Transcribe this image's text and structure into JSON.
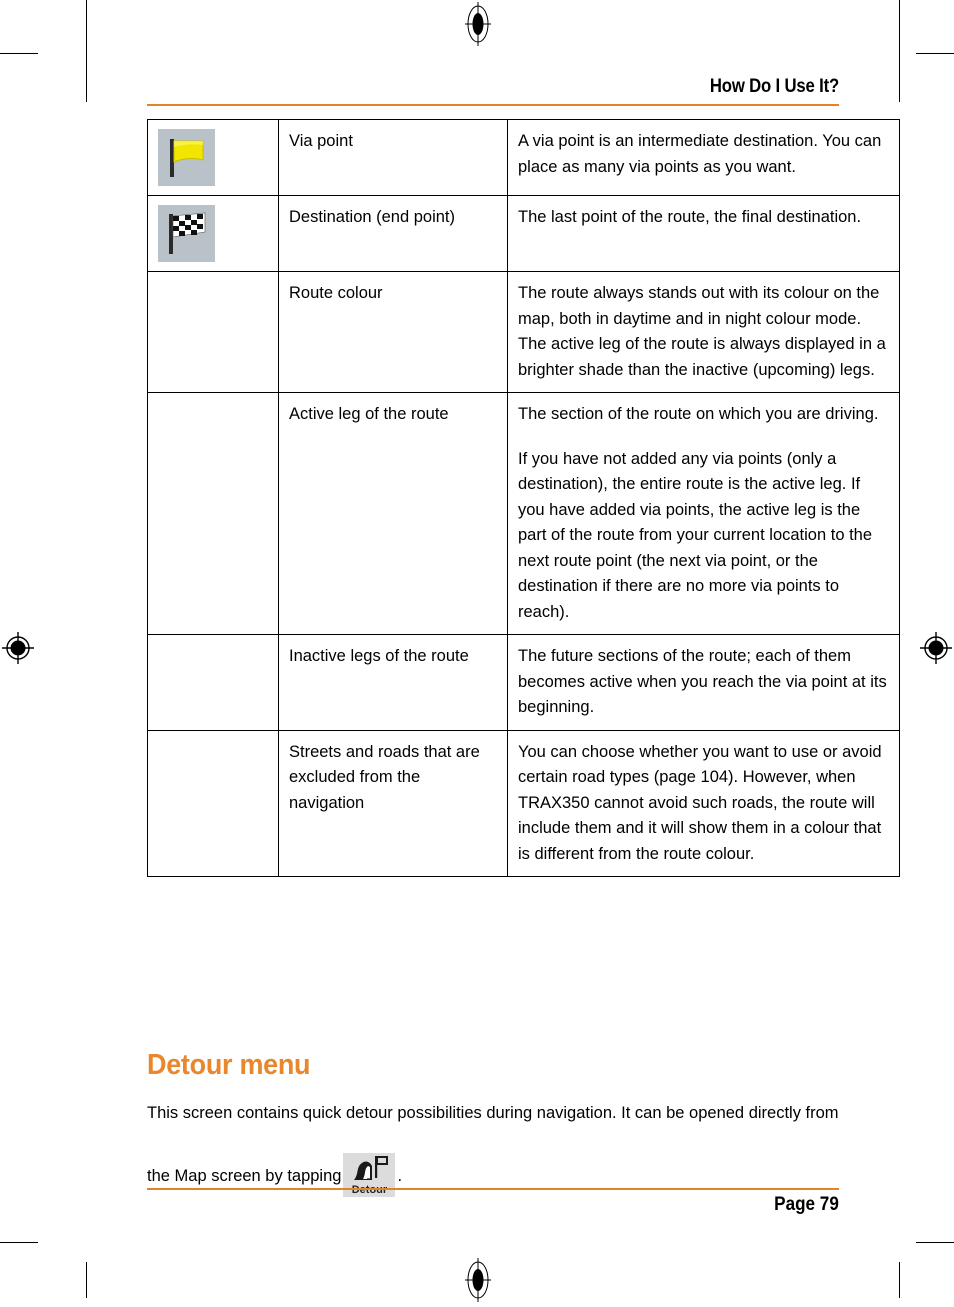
{
  "header": {
    "running_title": "How Do I Use It?"
  },
  "footer": {
    "page_label": "Page 79"
  },
  "colors": {
    "accent_orange": "#E18326",
    "heading_orange": "#E8872B",
    "icon_background": "#B9C2C9",
    "flag_yellow": "#F2E500"
  },
  "table": {
    "rows": [
      {
        "icon": "yellow-flag-icon",
        "term": "Via point",
        "paragraphs": [
          "A via point is an intermediate destination. You can place as many via points as you want."
        ]
      },
      {
        "icon": "checkered-flag-icon",
        "term": "Destination (end point)",
        "paragraphs": [
          "The last point of the route, the final destination."
        ]
      },
      {
        "icon": "",
        "term": "Route colour",
        "paragraphs": [
          "The route always stands out with its colour on the map, both in daytime and in night colour mode. The active leg of the route is always displayed in a brighter shade than the inactive (upcoming) legs."
        ]
      },
      {
        "icon": "",
        "term": "Active leg of the route",
        "paragraphs": [
          "The section of the route on which you are driving.",
          "If you have not added any via points (only a destination), the entire route is the active leg. If you have added via points, the active leg is the part of the route from your current location to the next route point (the next via point, or the destination if there are no more via points to reach)."
        ]
      },
      {
        "icon": "",
        "term": "Inactive legs of the route",
        "paragraphs": [
          "The future sections of the route; each of them becomes active when you reach the via point at its beginning."
        ]
      },
      {
        "icon": "",
        "term": "Streets and roads that are excluded from the navigation",
        "paragraphs": [
          "You can choose whether you want to use or avoid certain road types (page 104). However, when TRAX350 cannot avoid such roads, the route will include them and it will show them in a colour that is different from the route colour."
        ]
      }
    ]
  },
  "section": {
    "heading": "Detour menu",
    "paragraph_part1": "This screen contains quick detour possibilities during navigation. It can be opened directly from the Map screen by tapping",
    "paragraph_part2": ".",
    "button_label": "Detour",
    "button_icon": "detour-road-flag-icon"
  }
}
